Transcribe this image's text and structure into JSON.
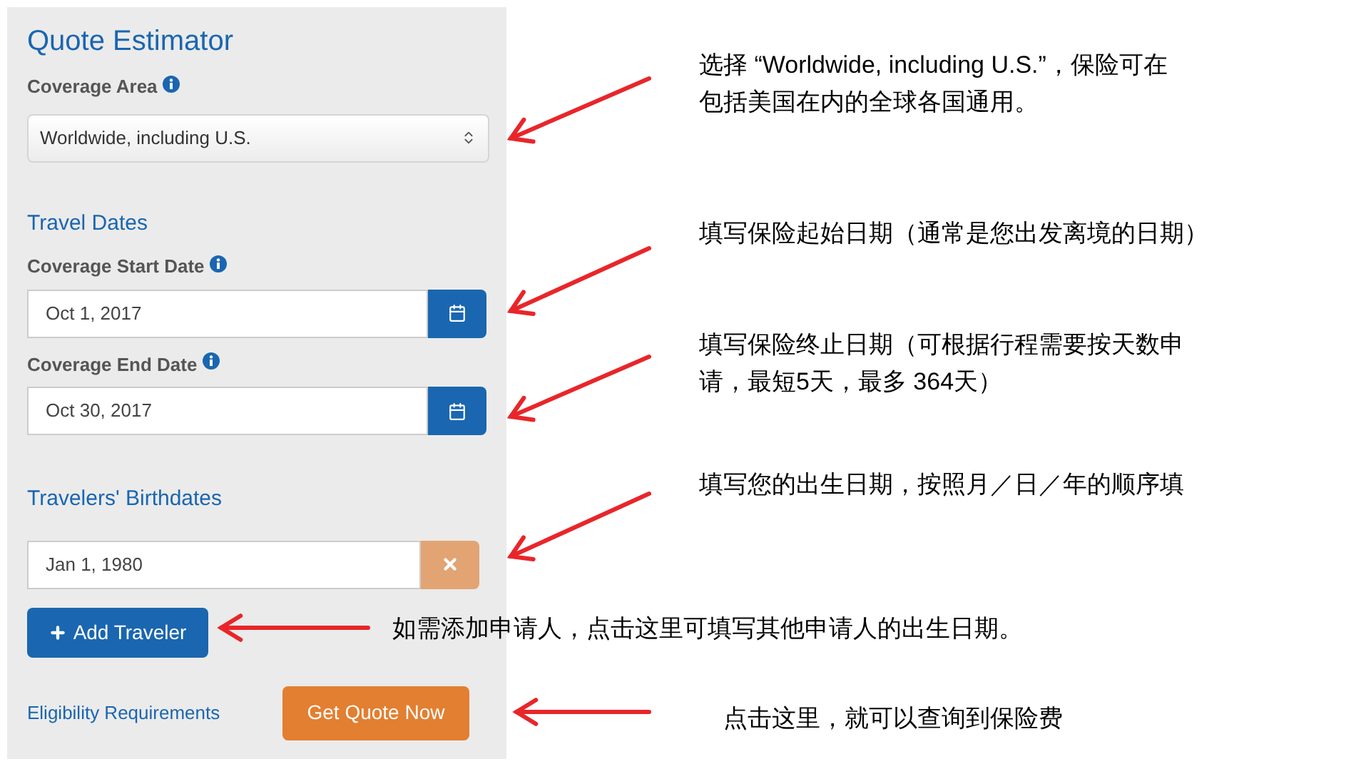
{
  "panel": {
    "title": "Quote Estimator",
    "coverage": {
      "label": "Coverage Area",
      "value": "Worldwide, including U.S."
    },
    "travel_dates": {
      "heading": "Travel Dates",
      "fields": [
        {
          "label": "Coverage Start Date",
          "value": "Oct 1, 2017"
        },
        {
          "label": "Coverage End Date",
          "value": "Oct 30, 2017"
        }
      ]
    },
    "birthdates": {
      "heading": "Travelers' Birthdates",
      "travelers": [
        {
          "value": "Jan 1, 1980"
        }
      ]
    },
    "add_button": "Add Traveler",
    "eligibility_link": "Eligibility Requirements",
    "quote_button": "Get Quote Now"
  },
  "annotations": [
    {
      "lines": [
        "选择 “Worldwide, including U.S.”，保险可在",
        "包括美国在内的全球各国通用。"
      ]
    },
    {
      "lines": [
        "填写保险起始日期（通常是您出发离境的日期）"
      ]
    },
    {
      "lines": [
        "填写保险终止日期（可根据行程需要按天数申",
        "请，最短5天，最多 364天）"
      ]
    },
    {
      "lines": [
        "填写您的出生日期，按照月／日／年的顺序填"
      ]
    },
    {
      "lines": [
        "如需添加申请人，点击这里可填写其他申请人的出生日期。"
      ]
    },
    {
      "lines": [
        "点击这里，就可以查询到保险费"
      ]
    }
  ]
}
